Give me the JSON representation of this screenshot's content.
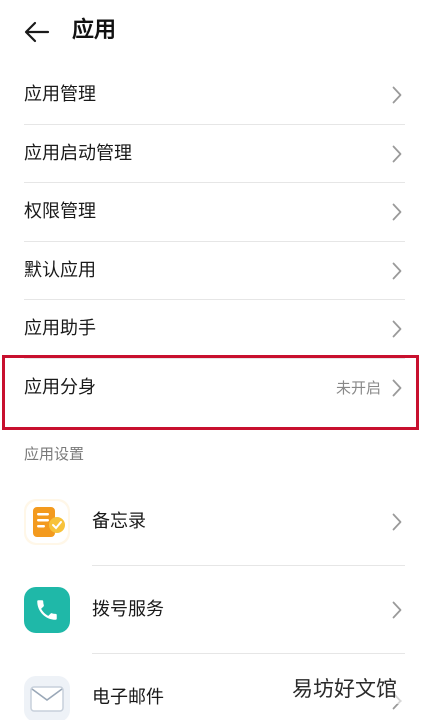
{
  "header": {
    "title": "应用",
    "back_icon": "arrow-left-icon"
  },
  "settings": [
    {
      "label": "应用管理",
      "value": ""
    },
    {
      "label": "应用启动管理",
      "value": ""
    },
    {
      "label": "权限管理",
      "value": ""
    },
    {
      "label": "默认应用",
      "value": ""
    },
    {
      "label": "应用助手",
      "value": ""
    },
    {
      "label": "应用分身",
      "value": "未开启"
    }
  ],
  "app_settings": {
    "section_title": "应用设置",
    "apps": [
      {
        "label": "备忘录",
        "icon": "memo-icon",
        "color": "#f5a623"
      },
      {
        "label": "拨号服务",
        "icon": "phone-icon",
        "color": "#1fb8a8"
      },
      {
        "label": "电子邮件",
        "icon": "mail-icon",
        "color": "#e8edf3"
      }
    ]
  },
  "watermark": "易坊好文馆",
  "colors": {
    "highlight": "#c8102e",
    "chevron": "#9a9a9a"
  }
}
